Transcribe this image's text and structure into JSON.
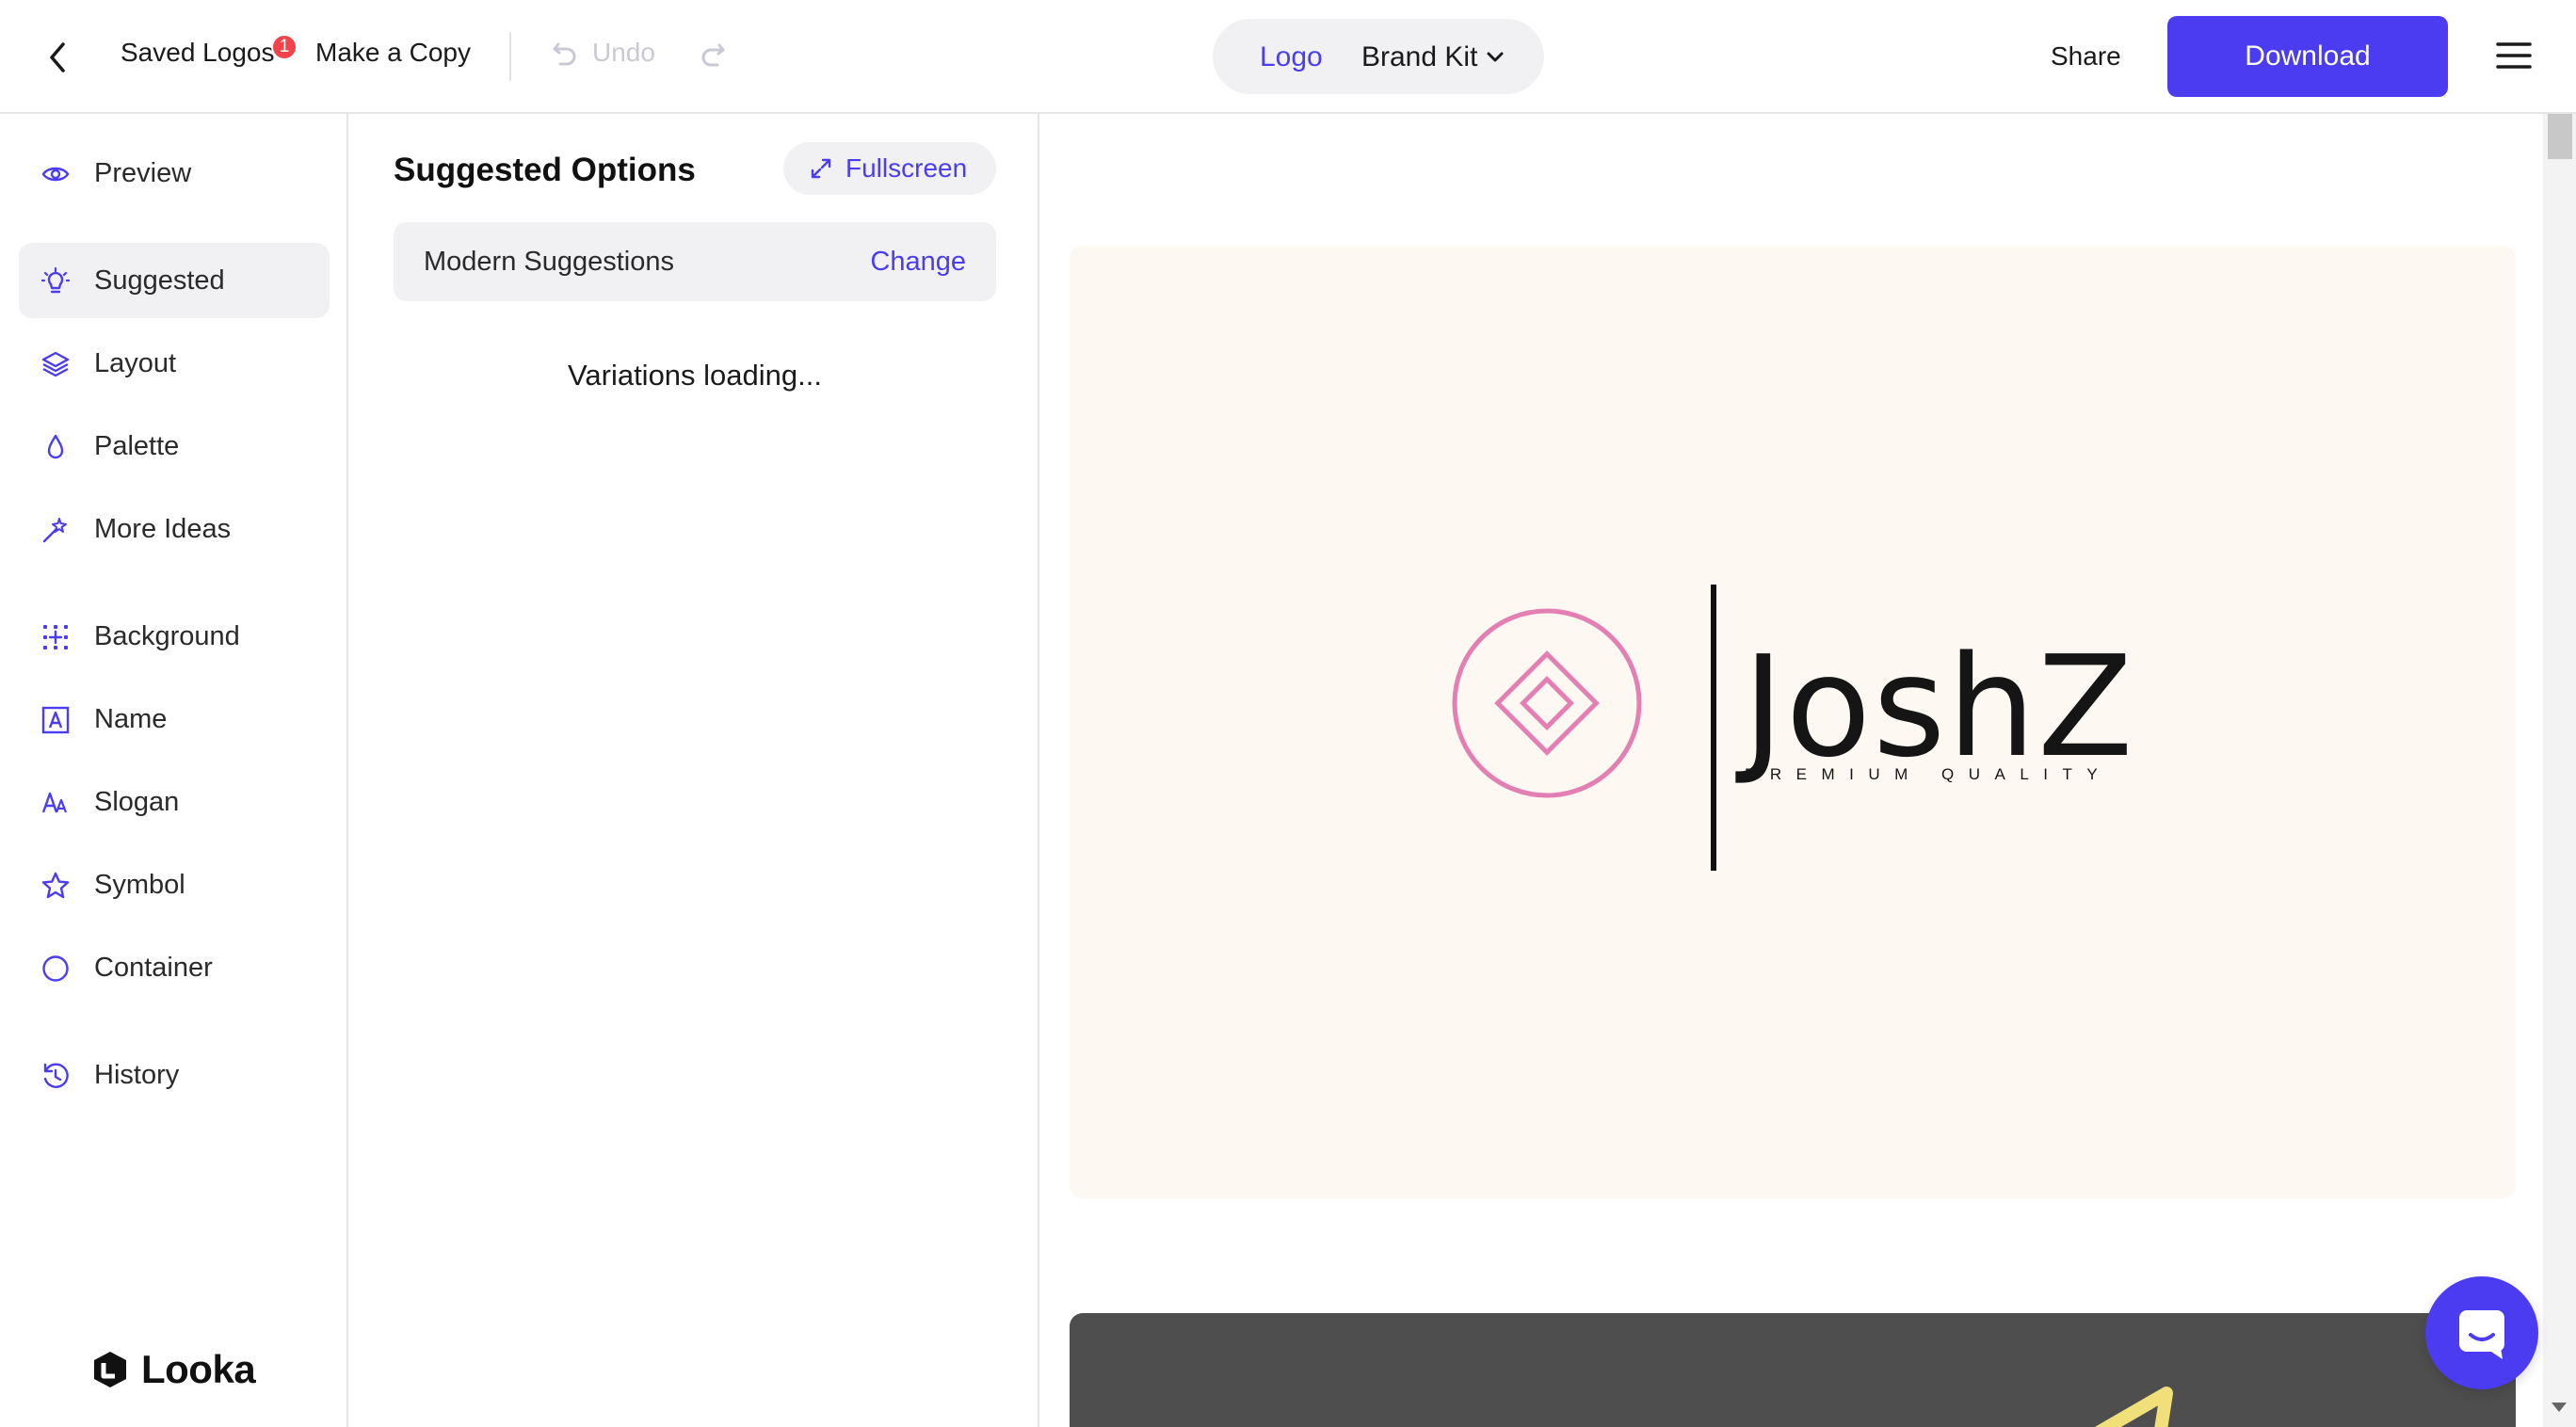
{
  "topbar": {
    "saved_logos_label": "Saved Logos",
    "saved_logos_badge": "1",
    "make_copy_label": "Make a Copy",
    "undo_label": "Undo",
    "tabs": {
      "logo_label": "Logo",
      "brand_kit_label": "Brand Kit"
    },
    "share_label": "Share",
    "download_label": "Download"
  },
  "sidebar": {
    "items": [
      {
        "label": "Preview",
        "icon": "eye-icon"
      },
      {
        "label": "Suggested",
        "icon": "lightbulb-icon",
        "active": true
      },
      {
        "label": "Layout",
        "icon": "layers-icon"
      },
      {
        "label": "Palette",
        "icon": "drop-icon"
      },
      {
        "label": "More Ideas",
        "icon": "magic-wand-icon"
      },
      {
        "label": "Background",
        "icon": "grid-icon"
      },
      {
        "label": "Name",
        "icon": "letter-a-box-icon"
      },
      {
        "label": "Slogan",
        "icon": "font-size-icon"
      },
      {
        "label": "Symbol",
        "icon": "star-icon"
      },
      {
        "label": "Container",
        "icon": "circle-icon"
      },
      {
        "label": "History",
        "icon": "history-icon"
      }
    ],
    "brand": "Looka"
  },
  "panel": {
    "title": "Suggested Options",
    "fullscreen_label": "Fullscreen",
    "style_label": "Modern Suggestions",
    "change_label": "Change",
    "loading_text": "Variations loading..."
  },
  "preview": {
    "logo_name": "JoshZ",
    "logo_slogan": "PREMIUM QUALITY"
  },
  "colors": {
    "accent": "#4b3cf2",
    "badge": "#f2434a",
    "logo_symbol": "#e47fb4",
    "card_background": "#fdf8f2"
  }
}
